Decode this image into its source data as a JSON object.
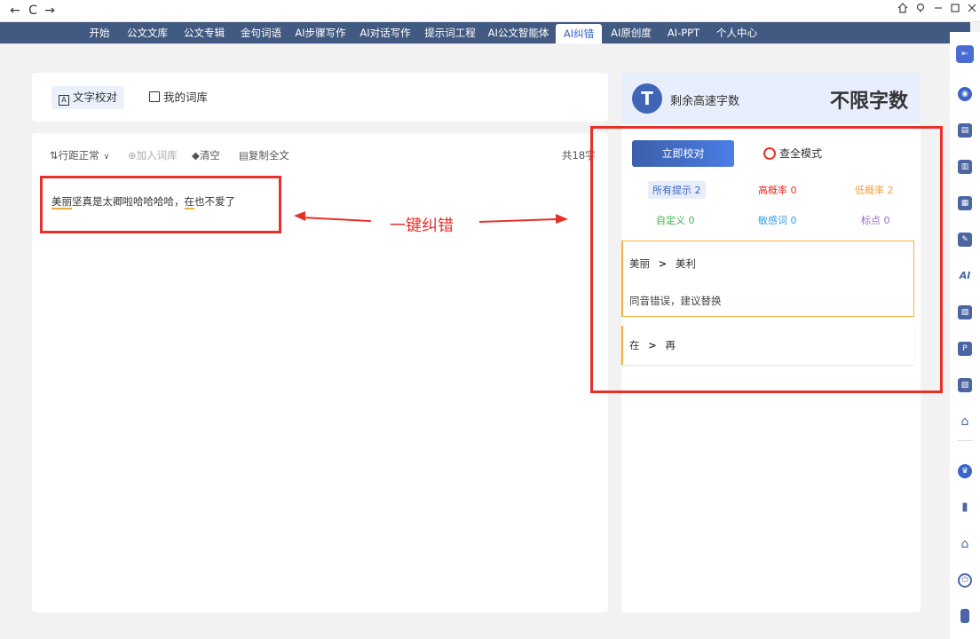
{
  "titlebar": {
    "back": "←",
    "refresh": "C",
    "forward": "→"
  },
  "nav": {
    "items": [
      "开始",
      "公文文库",
      "公文专辑",
      "金句词语",
      "AI步骤写作",
      "AI对话写作",
      "提示词工程",
      "AI公文智能体",
      "AI纠错",
      "AI原创度",
      "AI-PPT",
      "个人中心"
    ],
    "active_index": 8
  },
  "tabs": {
    "proofread": "文字校对",
    "lexicon": "我的词库"
  },
  "toolbar": {
    "line_spacing": "行距正常",
    "add_to_lexicon": "加入词库",
    "clear": "清空",
    "copy_all": "复制全文",
    "char_count": "共18字"
  },
  "editor": {
    "seg1": "美丽",
    "seg2": "坚真是太卿啦哈哈哈哈，",
    "seg3": "在",
    "seg4": "也不爱了"
  },
  "annotation": {
    "text": "一键纠错"
  },
  "quota": {
    "label": "剩余高速字数",
    "value": "不限字数",
    "logo": "T"
  },
  "actions": {
    "proofread_now": "立即校对",
    "full_check_mode": "查全模式"
  },
  "stats": {
    "all_hints": "所有提示 2",
    "high_prob": "高概率 0",
    "low_prob": "低概率 2",
    "custom": "自定义 0",
    "sensitive": "敏感词 0",
    "punctuation": "标点 0"
  },
  "suggestions": [
    {
      "original": "美丽",
      "arrow": ">",
      "replacement": "美利",
      "desc": "同音错误，建议替换"
    },
    {
      "original": "在",
      "arrow": ">",
      "replacement": "再"
    }
  ],
  "colors": {
    "nav": "#425a82",
    "accent": "#3a61c4",
    "annotation_red": "#e8302b",
    "warning": "#f5b041"
  }
}
